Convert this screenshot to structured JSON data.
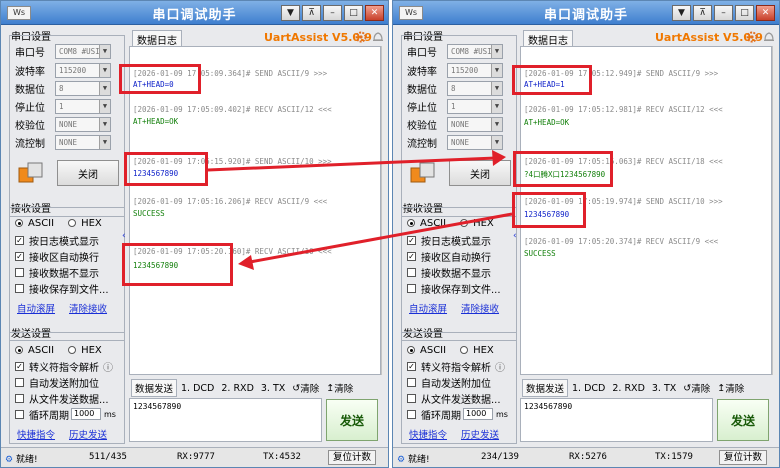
{
  "app": {
    "title": "串口调试助手",
    "brand": "UartAssist V5.0.9"
  },
  "window_buttons": {
    "system_menu": "Ws",
    "minimize": "▼",
    "pin": "⊼",
    "min": "–",
    "max": "□",
    "close": "✕"
  },
  "serial_settings": {
    "title": "串口设置",
    "fields": [
      {
        "label": "串口号",
        "value": "COM8 #USI"
      },
      {
        "label": "波特率",
        "value": "115200"
      },
      {
        "label": "数据位",
        "value": "8"
      },
      {
        "label": "停止位",
        "value": "1"
      },
      {
        "label": "校验位",
        "value": "NONE"
      },
      {
        "label": "流控制",
        "value": "NONE"
      }
    ],
    "close_button": "关闭"
  },
  "receive_settings": {
    "title": "接收设置",
    "ascii": "ASCII",
    "hex": "HEX",
    "options": [
      "按日志模式显示",
      "接收区自动换行",
      "接收数据不显示",
      "接收保存到文件..."
    ],
    "checked": [
      true,
      true,
      false,
      false
    ],
    "links": [
      "自动滚屏",
      "清除接收"
    ]
  },
  "send_settings": {
    "title": "发送设置",
    "ascii": "ASCII",
    "hex": "HEX",
    "options": [
      "转义符指令解析",
      "自动发送附加位",
      "从文件发送数据...",
      "循环周期"
    ],
    "checked": [
      true,
      false,
      false,
      false
    ],
    "info_icon": "ⓘ",
    "period_value": "1000",
    "period_unit": "ms",
    "links": [
      "快捷指令",
      "历史发送"
    ]
  },
  "log_tab": "数据日志",
  "send_bar": {
    "tab": "数据发送",
    "dcd": "1. DCD",
    "rxd": "2. RXD",
    "tx": "3. TX",
    "clear1": "清除",
    "clear2": "清除"
  },
  "send_text": "1234567890",
  "send_button": "发送",
  "left": {
    "log": [
      {
        "header": "[2026-01-09 17:05:09.364]# SEND ASCII/9 >>>",
        "body": "AT+HEAD=0",
        "kind": "send"
      },
      {
        "header": "[2026-01-09 17:05:09.402]# RECV ASCII/12 <<<",
        "body": "AT+HEAD=OK",
        "kind": "recv"
      },
      {
        "header": "[2026-01-09 17:05:15.920]# SEND ASCII/10 >>>",
        "body": "1234567890",
        "kind": "send"
      },
      {
        "header": "[2026-01-09 17:05:16.206]# RECV ASCII/9 <<<",
        "body": "SUCCESS",
        "kind": "recv"
      },
      {
        "header": "[2026-01-09 17:05:20.160]# RECV ASCII/10 <<<",
        "body": "1234567890",
        "kind": "recv"
      }
    ],
    "status": {
      "ready": "就绪!",
      "count": "511/435",
      "rx": "RX:9777",
      "tx": "TX:4532",
      "reset": "复位计数"
    }
  },
  "right": {
    "log": [
      {
        "header": "[2026-01-09 17:05:12.949]# SEND ASCII/9 >>>",
        "body": "AT+HEAD=1",
        "kind": "send"
      },
      {
        "header": "[2026-01-09 17:05:12.981]# RECV ASCII/12 <<<",
        "body": "AT+HEAD=OK",
        "kind": "recv"
      },
      {
        "header": "[2026-01-09 17:05:16.063]# RECV ASCII/18 <<<",
        "body": "?4口腾X口1234567890",
        "kind": "recv"
      },
      {
        "header": "[2026-01-09 17:05:19.974]# SEND ASCII/10 >>>",
        "body": "1234567890",
        "kind": "send"
      },
      {
        "header": "[2026-01-09 17:05:20.374]# RECV ASCII/9 <<<",
        "body": "SUCCESS",
        "kind": "recv"
      }
    ],
    "status": {
      "ready": "就绪!",
      "count": "234/139",
      "rx": "RX:5276",
      "tx": "TX:1579",
      "reset": "复位计数"
    }
  },
  "colors": {
    "send_text": "#1022c9",
    "recv_text": "#14800c",
    "timestamp": "#8a8a8a",
    "highlight": "#e0202a",
    "brand": "#f07800",
    "title_bar": "#3f7fcf"
  }
}
